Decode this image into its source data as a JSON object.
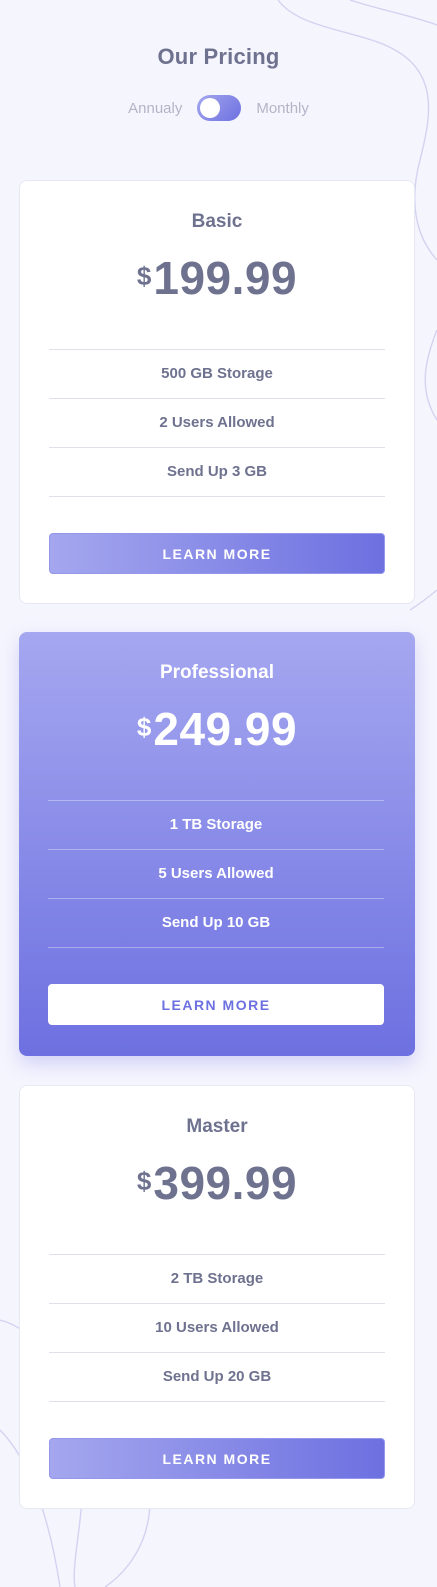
{
  "header": {
    "title": "Our Pricing",
    "toggle_left_label": "Annualy",
    "toggle_right_label": "Monthly"
  },
  "plans": [
    {
      "name": "Basic",
      "currency": "$",
      "price": "199.99",
      "features": [
        "500 GB Storage",
        "2 Users Allowed",
        "Send Up 3 GB"
      ],
      "button_label": "LEARN MORE"
    },
    {
      "name": "Professional",
      "currency": "$",
      "price": "249.99",
      "features": [
        "1 TB Storage",
        "5 Users Allowed",
        "Send Up 10 GB"
      ],
      "button_label": "LEARN MORE"
    },
    {
      "name": "Master",
      "currency": "$",
      "price": "399.99",
      "features": [
        "2 TB Storage",
        "10 Users Allowed",
        "Send Up 20 GB"
      ],
      "button_label": "LEARN MORE"
    }
  ],
  "colors": {
    "background": "#f5f5fe",
    "text": "#6e728f",
    "accent_light": "#a4a7ee",
    "accent_dark": "#6d70e0"
  }
}
